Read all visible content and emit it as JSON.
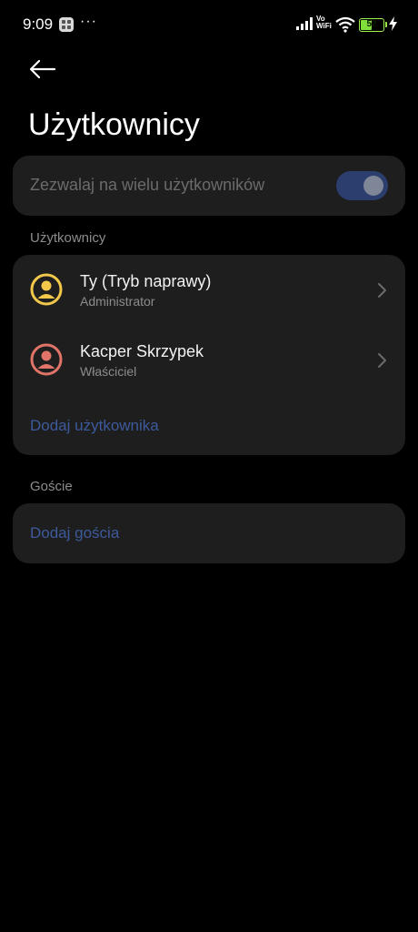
{
  "status_bar": {
    "time": "9:09",
    "more": "···",
    "vowifi_line1": "Vo",
    "vowifi_line2": "WiFi",
    "battery_level": "52",
    "battery_color": "#7fe03a"
  },
  "header": {
    "title": "Użytkownicy"
  },
  "multi_user": {
    "label": "Zezwalaj na wielu użytkowników",
    "enabled": true
  },
  "users_section": {
    "label": "Użytkownicy",
    "users": [
      {
        "name": "Ty (Tryb naprawy)",
        "role": "Administrator",
        "avatar_color": "#f2c84b",
        "icon": "person-icon"
      },
      {
        "name": "Kacper Skrzypek",
        "role": "Właściciel",
        "avatar_color": "#e07468",
        "icon": "person-icon"
      }
    ],
    "add_user": "Dodaj użytkownika"
  },
  "guests_section": {
    "label": "Goście",
    "add_guest": "Dodaj gościa"
  },
  "colors": {
    "background": "#000000",
    "card": "#1e1e1e",
    "accent_link": "#3d5a9c"
  }
}
